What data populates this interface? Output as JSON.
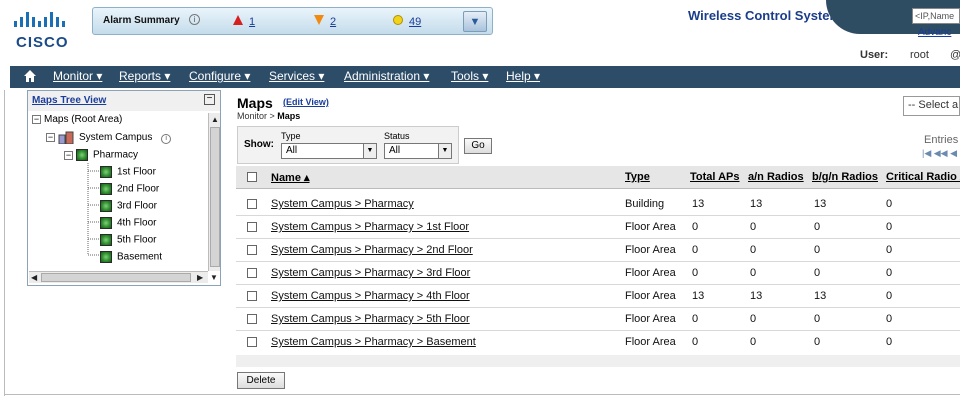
{
  "logo": {
    "text": "cisco"
  },
  "alarm_summary": {
    "title": "Alarm Summary",
    "critical": "1",
    "major": "2",
    "minor": "49",
    "colors": {
      "critical": "#d62020",
      "major": "#f08a10",
      "minor": "#f2d21a"
    }
  },
  "header": {
    "app_title": "Wireless Control System",
    "search_placeholder": "<IP,Name",
    "advanced_link": "Advanc",
    "user_label": "User:",
    "user_name": "root"
  },
  "nav": {
    "items": [
      "Monitor ▾",
      "Reports ▾",
      "Configure ▾",
      "Services ▾",
      "Administration ▾",
      "Tools ▾",
      "Help ▾"
    ]
  },
  "tree": {
    "title": "Maps Tree View",
    "root": "Maps (Root Area)",
    "campus": "System Campus",
    "building": "Pharmacy",
    "floors": [
      "1st Floor",
      "2nd Floor",
      "3rd Floor",
      "4th Floor",
      "5th Floor",
      "Basement"
    ]
  },
  "main": {
    "title": "Maps",
    "edit_view": "(Edit View)",
    "breadcrumb_prefix": "Monitor > ",
    "breadcrumb_current": "Maps",
    "select_placeholder": "-- Select a",
    "filter": {
      "show_label": "Show:",
      "type_label": "Type",
      "type_value": "All",
      "status_label": "Status",
      "status_value": "All",
      "go_label": "Go"
    },
    "entries_label": "Entries",
    "table": {
      "columns": [
        "Name ▴",
        "Type",
        "Total APs",
        "a/n Radios",
        "b/g/n Radios",
        "Critical Radio A"
      ],
      "rows": [
        {
          "name": "System Campus > Pharmacy",
          "type": "Building",
          "total_aps": "13",
          "an": "13",
          "bgn": "13",
          "critical": "0"
        },
        {
          "name": "System Campus > Pharmacy > 1st Floor",
          "type": "Floor Area",
          "total_aps": "0",
          "an": "0",
          "bgn": "0",
          "critical": "0"
        },
        {
          "name": "System Campus > Pharmacy > 2nd Floor",
          "type": "Floor Area",
          "total_aps": "0",
          "an": "0",
          "bgn": "0",
          "critical": "0"
        },
        {
          "name": "System Campus > Pharmacy > 3rd Floor",
          "type": "Floor Area",
          "total_aps": "0",
          "an": "0",
          "bgn": "0",
          "critical": "0"
        },
        {
          "name": "System Campus > Pharmacy > 4th Floor",
          "type": "Floor Area",
          "total_aps": "13",
          "an": "13",
          "bgn": "13",
          "critical": "0"
        },
        {
          "name": "System Campus > Pharmacy > 5th Floor",
          "type": "Floor Area",
          "total_aps": "0",
          "an": "0",
          "bgn": "0",
          "critical": "0"
        },
        {
          "name": "System Campus > Pharmacy > Basement",
          "type": "Floor Area",
          "total_aps": "0",
          "an": "0",
          "bgn": "0",
          "critical": "0"
        }
      ]
    },
    "delete_label": "Delete"
  }
}
